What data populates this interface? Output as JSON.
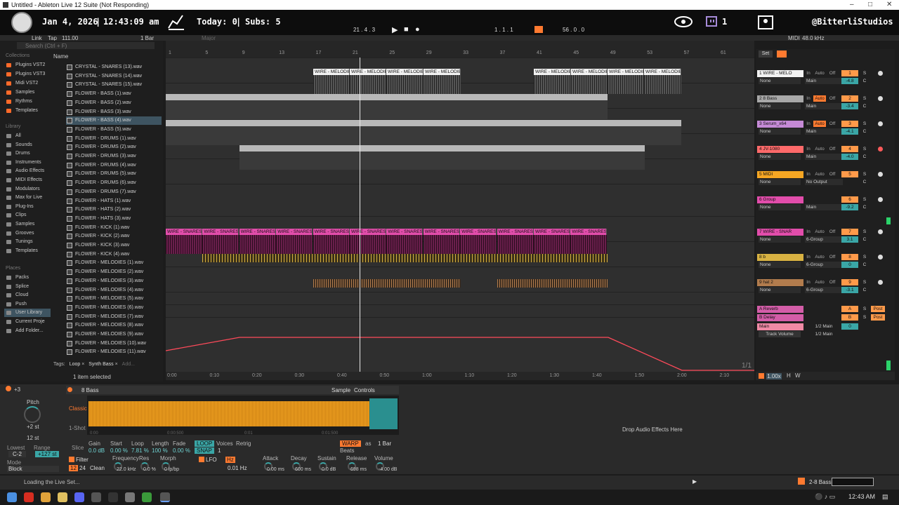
{
  "window": {
    "title": "Untitled - Ableton Live 12 Suite (Not Responding)"
  },
  "overlay": {
    "date": "Jan 4, 2026",
    "time": "12:43:09 am",
    "today": "Today: 0",
    "subs": "Subs: 5",
    "viewers": "1",
    "channel": "@BitterliStudios"
  },
  "transport": {
    "tap": "Tap",
    "tempo": "111.00",
    "link": "Link",
    "meter": "1 Bar",
    "position": "21 . 4 . 3",
    "loop_start": "1 . 1 . 1",
    "loop_length": "56 . 0 . 0",
    "sample_rate": "48.0 kHz",
    "midi": "MIDI",
    "key": "Major"
  },
  "browser": {
    "search_placeholder": "Search (Ctrl + F)",
    "collections_label": "Collections",
    "collections": [
      "Plugins VST2",
      "Plugins VST3",
      "Midi VST2",
      "Samples",
      "Rythms",
      "Templates"
    ],
    "library_label": "Library",
    "library": [
      "All",
      "Sounds",
      "Drums",
      "Instruments",
      "Audio Effects",
      "MIDI Effects",
      "Modulators",
      "Max for Live",
      "Plug-Ins",
      "Clips",
      "Samples",
      "Grooves",
      "Tunings",
      "Templates"
    ],
    "places_label": "Places",
    "places": [
      "Packs",
      "Splice",
      "Cloud",
      "Push",
      "User Library",
      "Current Proje",
      "Add Folder..."
    ],
    "name_header": "Name",
    "files": [
      "CRYSTAL - SNARES (13).wav",
      "CRYSTAL - SNARES (14).wav",
      "CRYSTAL - SNARES (15).wav",
      "FLOWER - BASS (1).wav",
      "FLOWER - BASS (2).wav",
      "FLOWER - BASS (3).wav",
      "FLOWER - BASS (4).wav",
      "FLOWER - BASS (5).wav",
      "FLOWER - DRUMS (1).wav",
      "FLOWER - DRUMS (2).wav",
      "FLOWER - DRUMS (3).wav",
      "FLOWER - DRUMS (4).wav",
      "FLOWER - DRUMS (5).wav",
      "FLOWER - DRUMS (6).wav",
      "FLOWER - DRUMS (7).wav",
      "FLOWER - HATS (1).wav",
      "FLOWER - HATS (2).wav",
      "FLOWER - HATS (3).wav",
      "FLOWER - KICK (1).wav",
      "FLOWER - KICK (2).wav",
      "FLOWER - KICK (3).wav",
      "FLOWER - KICK (4).wav",
      "FLOWER - MELODIES (1).wav",
      "FLOWER - MELODIES (2).wav",
      "FLOWER - MELODIES (3).wav",
      "FLOWER - MELODIES (4).wav",
      "FLOWER - MELODIES (5).wav",
      "FLOWER - MELODIES (6).wav",
      "FLOWER - MELODIES (7).wav",
      "FLOWER - MELODIES (8).wav",
      "FLOWER - MELODIES (9).wav",
      "FLOWER - MELODIES (10).wav",
      "FLOWER - MELODIES (11).wav"
    ],
    "tags_label": "Tags:",
    "tags": [
      "Loop",
      "Synth Bass"
    ],
    "tag_add": "Add...",
    "selected_info": "1 item selected"
  },
  "ruler": {
    "bars": [
      "1",
      "5",
      "9",
      "13",
      "17",
      "21",
      "25",
      "29",
      "33",
      "37",
      "41",
      "45",
      "49",
      "53",
      "57",
      "61"
    ],
    "times": [
      "0:00",
      "0:10",
      "0:20",
      "0:30",
      "0:40",
      "0:50",
      "1:00",
      "1:10",
      "1:20",
      "1:30",
      "1:40",
      "1:50",
      "2:00",
      "2:10"
    ],
    "page": "1/1"
  },
  "clips": {
    "melodie": "WIRE - MELODIE",
    "snares": "WIRE - SNARES"
  },
  "tracks": [
    {
      "name": "1 WIRE - MELO",
      "color": "#f2f2f2",
      "input": "None",
      "output": "Main",
      "num": "1",
      "vol": "-4.8"
    },
    {
      "name": "2 8 Bass",
      "color": "#a8a8a8",
      "input": "None",
      "output": "Main",
      "num": "2",
      "vol": "-3.4"
    },
    {
      "name": "3 Serum_x64",
      "color": "#c58ad6",
      "input": "None",
      "output": "Main",
      "num": "3",
      "vol": "-4.1"
    },
    {
      "name": "4 JV-1080",
      "color": "#ff6a6a",
      "input": "None",
      "output": "Main",
      "num": "4",
      "vol": "-4.0"
    },
    {
      "name": "5 MIDI",
      "color": "#f5a623",
      "input": "None",
      "output": "No Output",
      "num": "5",
      "vol": ""
    },
    {
      "name": "6 Group",
      "color": "#e24dab",
      "input": "None",
      "output": "Main",
      "num": "6",
      "vol": "-9.2"
    },
    {
      "name": "7 WIRE - SNAR",
      "color": "#e24dab",
      "input": "None",
      "output": "6-Group",
      "num": "7",
      "vol": "3.1"
    },
    {
      "name": "8 b",
      "color": "#d8b242",
      "input": "None",
      "output": "6-Group",
      "num": "8",
      "vol": "0"
    },
    {
      "name": "9 hat 2",
      "color": "#b27c4d",
      "input": "None",
      "output": "6-Group",
      "num": "9",
      "vol": "-3.1"
    }
  ],
  "returns": [
    {
      "name": "A Reverb",
      "color": "#d35da8",
      "letter": "A"
    },
    {
      "name": "B Delay",
      "color": "#d35da8",
      "letter": "B"
    }
  ],
  "master": {
    "name": "Main",
    "vol": "0",
    "routing": "1/2 Main",
    "automation": "Track Volume"
  },
  "mixer_labels": {
    "in": "In",
    "auto": "Auto",
    "off": "Off",
    "s": "S",
    "c": "C",
    "post": "Post",
    "set": "Set"
  },
  "zoom": "1.00x",
  "device": {
    "title": "8 Bass",
    "tabs": [
      "Sample",
      "Controls"
    ],
    "mode": "Classic",
    "oneshot": "1-Shot",
    "slice": "Slice",
    "pitch_label": "Pitch",
    "pitch_value": "+2 st",
    "st_value": "12 st",
    "lowest_label": "Lowest",
    "lowest_value": "C-2",
    "range_label": "Range",
    "range_value": "+127 st",
    "mode_label": "Mode",
    "mode_value": "Block",
    "gain": "Gain",
    "gain_v": "0.0 dB",
    "start": "Start",
    "start_v": "0.00 %",
    "loop": "Loop",
    "loop_v": "7.81 %",
    "length": "Length",
    "length_v": "100 %",
    "fade": "Fade",
    "fade_v": "0.00 %",
    "loop_btn": "LOOP",
    "snap_btn": "SNAP",
    "voices": "Voices",
    "voices_v": "1",
    "retrig": "Retrig",
    "warp": "WARP",
    "as": "as",
    "bar": "1 Bar",
    "beats": "Beats",
    "filter": "Filter",
    "clean": "Clean",
    "f24": "24",
    "f12": "12",
    "frequency": "Frequency",
    "freq_v": "22.0 kHz",
    "res": "Res",
    "res_v": "0.0 %",
    "morph": "Morph",
    "morph_v": "0 lp/bp",
    "lfo": "LFO",
    "hz": "Hz",
    "lfo_v": "0.01 Hz",
    "attack": "Attack",
    "attack_v": "0.00 ms",
    "decay": "Decay",
    "decay_v": "600 ms",
    "sustain": "Sustain",
    "sustain_v": "0.0 dB",
    "release": "Release",
    "release_v": "698 ms",
    "volume": "Volume",
    "volume_v": "-4.00 dB",
    "ruler_marks": [
      "0:00",
      "0:00:500",
      "0:01",
      "0:01:500"
    ],
    "drop": "Drop Audio Effects Here",
    "plus3": "+3"
  },
  "status": {
    "text": "Loading the Live Set...",
    "track": "2-8 Bass"
  },
  "taskbar": {
    "time": "12:43 AM"
  }
}
